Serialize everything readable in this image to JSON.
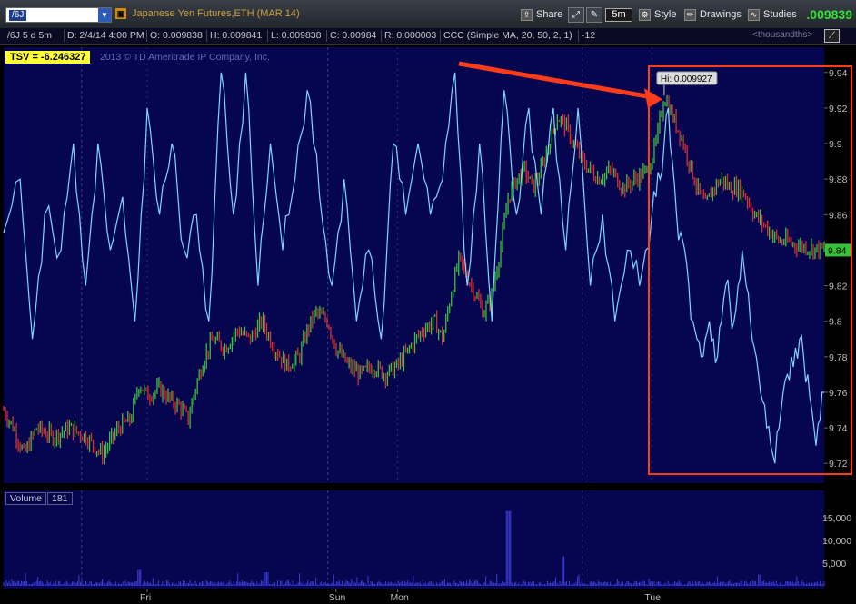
{
  "toolbar": {
    "symbol_tag": "/6J",
    "title": "Japanese Yen Futures,ETH (MAR 14)",
    "share_label": "Share",
    "timeframe_label": "5m",
    "style_label": "Style",
    "drawings_label": "Drawings",
    "studies_label": "Studies",
    "last_price": ".009839"
  },
  "infobar": {
    "symbol_period": "/6J 5 d 5m",
    "date": "D: 2/4/14 4:00 PM",
    "open": "O: 0.009838",
    "high": "H: 0.009841",
    "low": "L: 0.009838",
    "close": "C: 0.00984",
    "range": "R: 0.000003",
    "study": "CCC (Simple MA, 20, 50, 2, 1)",
    "study_value": "-12",
    "units": "<thousandths>"
  },
  "chart": {
    "tsv_label": "TSV = -6.246327",
    "copyright": "2013 © TD Ameritrade IP Company, Inc.",
    "hi_label": "Hi: 0.009927",
    "current_price_label": "9.84",
    "colors": {
      "background": "#050550",
      "tsv_line": "#7fd7ff",
      "up_bar": "#3fbf3f",
      "down_bar": "#d83030",
      "annotation": "#ff3b1a"
    }
  },
  "chart_data": {
    "type": "line",
    "price_axis": {
      "ticks": [
        "9.94",
        "9.92",
        "9.9",
        "9.88",
        "9.86",
        "9.84",
        "9.82",
        "9.8",
        "9.78",
        "9.76",
        "9.74",
        "9.72"
      ],
      "range": [
        9.715,
        9.945
      ],
      "unit": "thousandths"
    },
    "volume_axis": {
      "ticks": [
        "15,000",
        "10,000",
        "5,000"
      ],
      "range": [
        0,
        18000
      ]
    },
    "x_axis_labels": [
      "Fri",
      "Sun",
      "Mon",
      "Tue"
    ],
    "volume_label": "Volume",
    "volume_value": "181",
    "high_value": 9.927,
    "last_value": 9.84,
    "price_path": [
      [
        0,
        9.75
      ],
      [
        0.012,
        9.74
      ],
      [
        0.025,
        9.725
      ],
      [
        0.04,
        9.74
      ],
      [
        0.06,
        9.735
      ],
      [
        0.08,
        9.74
      ],
      [
        0.1,
        9.735
      ],
      [
        0.12,
        9.725
      ],
      [
        0.14,
        9.74
      ],
      [
        0.155,
        9.745
      ],
      [
        0.165,
        9.765
      ],
      [
        0.175,
        9.758
      ],
      [
        0.19,
        9.762
      ],
      [
        0.205,
        9.755
      ],
      [
        0.215,
        9.752
      ],
      [
        0.225,
        9.745
      ],
      [
        0.235,
        9.765
      ],
      [
        0.245,
        9.78
      ],
      [
        0.255,
        9.79
      ],
      [
        0.27,
        9.785
      ],
      [
        0.285,
        9.795
      ],
      [
        0.3,
        9.79
      ],
      [
        0.315,
        9.8
      ],
      [
        0.33,
        9.785
      ],
      [
        0.345,
        9.775
      ],
      [
        0.36,
        9.78
      ],
      [
        0.37,
        9.795
      ],
      [
        0.38,
        9.805
      ],
      [
        0.395,
        9.8
      ],
      [
        0.405,
        9.785
      ],
      [
        0.42,
        9.775
      ],
      [
        0.435,
        9.77
      ],
      [
        0.45,
        9.775
      ],
      [
        0.465,
        9.77
      ],
      [
        0.48,
        9.775
      ],
      [
        0.495,
        9.785
      ],
      [
        0.51,
        9.795
      ],
      [
        0.525,
        9.8
      ],
      [
        0.535,
        9.79
      ],
      [
        0.545,
        9.815
      ],
      [
        0.555,
        9.835
      ],
      [
        0.565,
        9.825
      ],
      [
        0.575,
        9.815
      ],
      [
        0.585,
        9.805
      ],
      [
        0.595,
        9.815
      ],
      [
        0.605,
        9.84
      ],
      [
        0.615,
        9.87
      ],
      [
        0.625,
        9.88
      ],
      [
        0.635,
        9.885
      ],
      [
        0.645,
        9.875
      ],
      [
        0.655,
        9.885
      ],
      [
        0.665,
        9.9
      ],
      [
        0.675,
        9.915
      ],
      [
        0.685,
        9.91
      ],
      [
        0.695,
        9.9
      ],
      [
        0.705,
        9.89
      ],
      [
        0.715,
        9.885
      ],
      [
        0.725,
        9.88
      ],
      [
        0.74,
        9.885
      ],
      [
        0.755,
        9.875
      ],
      [
        0.77,
        9.88
      ],
      [
        0.785,
        9.885
      ],
      [
        0.795,
        9.9
      ],
      [
        0.805,
        9.927
      ],
      [
        0.815,
        9.915
      ],
      [
        0.825,
        9.905
      ],
      [
        0.835,
        9.89
      ],
      [
        0.845,
        9.875
      ],
      [
        0.855,
        9.865
      ],
      [
        0.865,
        9.875
      ],
      [
        0.875,
        9.88
      ],
      [
        0.885,
        9.875
      ],
      [
        0.895,
        9.875
      ],
      [
        0.905,
        9.87
      ],
      [
        0.915,
        9.86
      ],
      [
        0.925,
        9.855
      ],
      [
        0.935,
        9.85
      ],
      [
        0.945,
        9.845
      ],
      [
        0.955,
        9.845
      ],
      [
        0.965,
        9.843
      ],
      [
        0.975,
        9.842
      ],
      [
        0.985,
        9.841
      ],
      [
        1.0,
        9.84
      ]
    ],
    "tsv_path": [
      [
        0,
        9.85
      ],
      [
        0.02,
        9.88
      ],
      [
        0.035,
        9.79
      ],
      [
        0.05,
        9.86
      ],
      [
        0.07,
        9.84
      ],
      [
        0.085,
        9.9
      ],
      [
        0.1,
        9.82
      ],
      [
        0.115,
        9.9
      ],
      [
        0.13,
        9.84
      ],
      [
        0.145,
        9.87
      ],
      [
        0.16,
        9.8
      ],
      [
        0.175,
        9.92
      ],
      [
        0.19,
        9.86
      ],
      [
        0.205,
        9.9
      ],
      [
        0.22,
        9.84
      ],
      [
        0.235,
        9.86
      ],
      [
        0.25,
        9.8
      ],
      [
        0.265,
        9.94
      ],
      [
        0.28,
        9.86
      ],
      [
        0.295,
        9.94
      ],
      [
        0.31,
        9.82
      ],
      [
        0.325,
        9.9
      ],
      [
        0.34,
        9.84
      ],
      [
        0.355,
        9.88
      ],
      [
        0.37,
        9.93
      ],
      [
        0.385,
        9.87
      ],
      [
        0.4,
        9.82
      ],
      [
        0.415,
        9.88
      ],
      [
        0.43,
        9.8
      ],
      [
        0.445,
        9.84
      ],
      [
        0.46,
        9.79
      ],
      [
        0.475,
        9.9
      ],
      [
        0.49,
        9.86
      ],
      [
        0.505,
        9.9
      ],
      [
        0.52,
        9.86
      ],
      [
        0.535,
        9.88
      ],
      [
        0.55,
        9.94
      ],
      [
        0.565,
        9.82
      ],
      [
        0.58,
        9.9
      ],
      [
        0.595,
        9.8
      ],
      [
        0.61,
        9.93
      ],
      [
        0.625,
        9.86
      ],
      [
        0.64,
        9.92
      ],
      [
        0.655,
        9.86
      ],
      [
        0.67,
        9.92
      ],
      [
        0.685,
        9.84
      ],
      [
        0.7,
        9.92
      ],
      [
        0.715,
        9.82
      ],
      [
        0.73,
        9.86
      ],
      [
        0.745,
        9.8
      ],
      [
        0.76,
        9.84
      ],
      [
        0.775,
        9.82
      ],
      [
        0.79,
        9.86
      ],
      [
        0.8,
        9.88
      ],
      [
        0.81,
        9.92
      ],
      [
        0.82,
        9.86
      ],
      [
        0.83,
        9.84
      ],
      [
        0.84,
        9.8
      ],
      [
        0.85,
        9.78
      ],
      [
        0.86,
        9.8
      ],
      [
        0.87,
        9.78
      ],
      [
        0.88,
        9.82
      ],
      [
        0.89,
        9.8
      ],
      [
        0.9,
        9.84
      ],
      [
        0.91,
        9.8
      ],
      [
        0.92,
        9.77
      ],
      [
        0.93,
        9.74
      ],
      [
        0.94,
        9.72
      ],
      [
        0.95,
        9.76
      ],
      [
        0.96,
        9.78
      ],
      [
        0.97,
        9.79
      ],
      [
        0.98,
        9.77
      ],
      [
        0.99,
        9.73
      ],
      [
        1.0,
        9.76
      ]
    ]
  }
}
